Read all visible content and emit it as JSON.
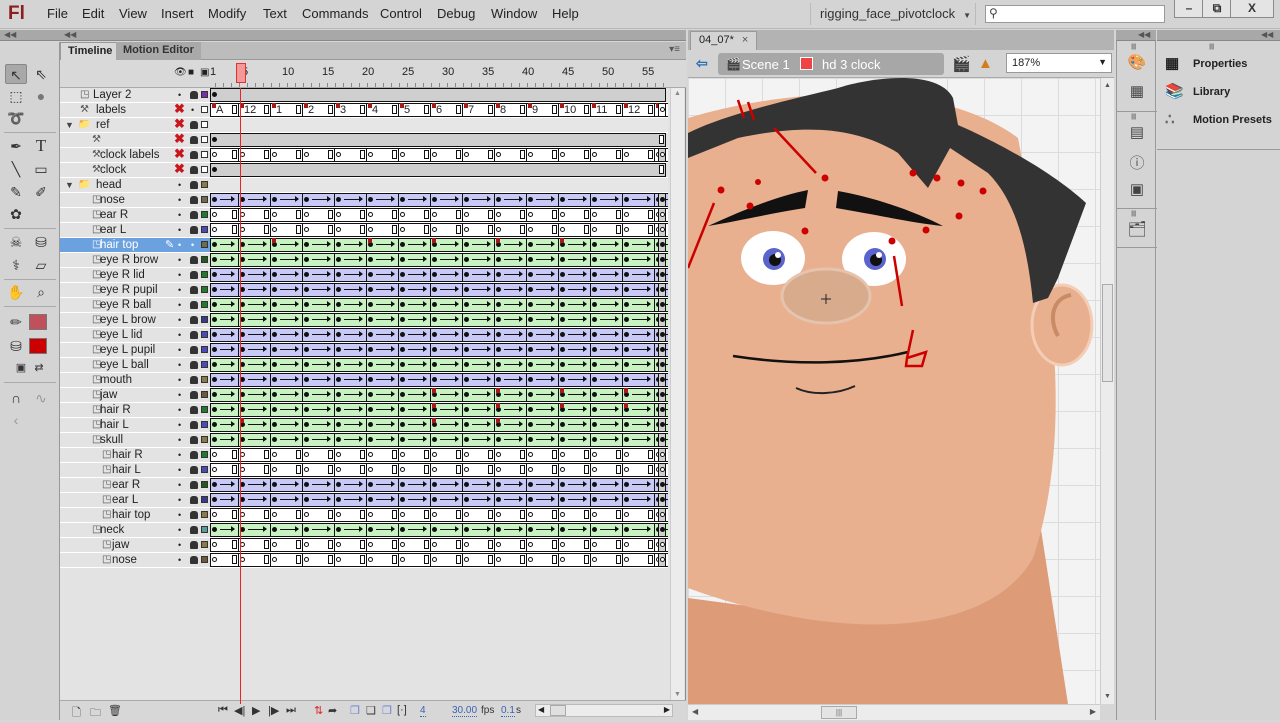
{
  "app": {
    "logo": "Fl",
    "menu": [
      "File",
      "Edit",
      "View",
      "Insert",
      "Modify",
      "Text",
      "Commands",
      "Control",
      "Debug",
      "Window",
      "Help"
    ],
    "workspace": "rigging_face_pivotclock",
    "search_placeholder": "",
    "window_buttons": {
      "minimize": "–",
      "restore": "⧉",
      "close": "X"
    }
  },
  "toolbox": {
    "tools": [
      {
        "name": "selection-tool",
        "glyph": "↖",
        "active": true
      },
      {
        "name": "subselection-tool",
        "glyph": "⇖"
      },
      {
        "name": "free-transform-tool",
        "glyph": "⬚"
      },
      {
        "name": "3d-rotation-tool",
        "glyph": "●"
      },
      {
        "name": "lasso-tool",
        "glyph": "➰"
      },
      {
        "name": "pen-tool",
        "glyph": "✒"
      },
      {
        "name": "text-tool",
        "glyph": "T"
      },
      {
        "name": "line-tool",
        "glyph": "╲"
      },
      {
        "name": "rectangle-tool",
        "glyph": "▭"
      },
      {
        "name": "pencil-tool",
        "glyph": "✎"
      },
      {
        "name": "brush-tool",
        "glyph": "✐"
      },
      {
        "name": "deco-tool",
        "glyph": "✿"
      },
      {
        "name": "bone-tool",
        "glyph": "☠"
      },
      {
        "name": "paint-bucket-tool",
        "glyph": "⛁"
      },
      {
        "name": "eyedropper-tool",
        "glyph": "⚕"
      },
      {
        "name": "eraser-tool",
        "glyph": "▱"
      },
      {
        "name": "hand-tool",
        "glyph": "✋"
      },
      {
        "name": "zoom-tool",
        "glyph": "⌕"
      },
      {
        "name": "stroke-color-tool",
        "glyph": "✏"
      },
      {
        "name": "fill-color-tool",
        "glyph": "⛁"
      },
      {
        "name": "default-colors-tool",
        "glyph": "▣"
      },
      {
        "name": "swap-colors-tool",
        "glyph": "⇄"
      },
      {
        "name": "snap-to-objects-tool",
        "glyph": "∩"
      },
      {
        "name": "smooth-tool",
        "glyph": "∿"
      },
      {
        "name": "straighten-tool",
        "glyph": "‹"
      }
    ],
    "stroke_color": "#c0505a",
    "fill_color": "#cc0000"
  },
  "timeline": {
    "tabs": [
      {
        "label": "Timeline",
        "active": true
      },
      {
        "label": "Motion Editor",
        "active": false
      }
    ],
    "ruler": [
      "1",
      "5",
      "10",
      "15",
      "20",
      "25",
      "30",
      "35",
      "40",
      "45",
      "50",
      "55"
    ],
    "current_frame": "4",
    "fps": "30.00",
    "fps_unit": "fps",
    "elapsed": "0.1",
    "elapsed_unit": "s",
    "total_frames": 57,
    "layers": [
      {
        "name": "Layer 2",
        "depth": 0,
        "kind": "layer",
        "frames": "gray-single",
        "color": "#7a2fa8"
      },
      {
        "name": "labels",
        "depth": 0,
        "kind": "guide",
        "frames": "labels",
        "hidden": true,
        "color": "#ffffff"
      },
      {
        "name": "ref",
        "depth": 0,
        "kind": "folder",
        "frames": "folder",
        "hidden": true,
        "color": "#ffffff"
      },
      {
        "name": "",
        "depth": 1,
        "kind": "guide",
        "frames": "gray-single-end",
        "hidden": true,
        "color": "#ffffff"
      },
      {
        "name": "clock labels",
        "depth": 1,
        "kind": "guide",
        "frames": "white",
        "hidden": true,
        "color": "#ffffff"
      },
      {
        "name": "clock",
        "depth": 1,
        "kind": "guide",
        "frames": "gray-single-end",
        "hidden": true,
        "color": "#ffffff"
      },
      {
        "name": "head",
        "depth": 0,
        "kind": "folder",
        "frames": "folder",
        "color": "#8a7a4a"
      },
      {
        "name": "nose",
        "depth": 1,
        "kind": "layer",
        "frames": "blue",
        "color": "#6e6a4a"
      },
      {
        "name": "ear R",
        "depth": 1,
        "kind": "layer",
        "frames": "white",
        "color": "#1f7a2a"
      },
      {
        "name": "ear L",
        "depth": 1,
        "kind": "layer",
        "frames": "white",
        "color": "#4a4ab8"
      },
      {
        "name": "hair top",
        "depth": 1,
        "kind": "layer",
        "frames": "green",
        "selected": true,
        "flags": [
          8,
          20,
          28,
          36,
          44
        ],
        "color": "#6e6a4a"
      },
      {
        "name": "eye R brow",
        "depth": 1,
        "kind": "layer",
        "frames": "green",
        "color": "#1f5a1f"
      },
      {
        "name": "eye R lid",
        "depth": 1,
        "kind": "layer",
        "frames": "blue",
        "color": "#1f7a2a"
      },
      {
        "name": "eye R pupil",
        "depth": 1,
        "kind": "layer",
        "frames": "blue",
        "color": "#1f7a2a"
      },
      {
        "name": "eye R ball",
        "depth": 1,
        "kind": "layer",
        "frames": "green",
        "color": "#1f7a2a"
      },
      {
        "name": "eye L brow",
        "depth": 1,
        "kind": "layer",
        "frames": "green",
        "color": "#3a3a8a"
      },
      {
        "name": "eye L lid",
        "depth": 1,
        "kind": "layer",
        "frames": "blue",
        "color": "#4a4ab8"
      },
      {
        "name": "eye L pupil",
        "depth": 1,
        "kind": "layer",
        "frames": "blue",
        "color": "#4a4ab8"
      },
      {
        "name": "eye L ball",
        "depth": 1,
        "kind": "layer",
        "frames": "green",
        "color": "#4a4ab8"
      },
      {
        "name": "mouth",
        "depth": 1,
        "kind": "layer",
        "frames": "blue",
        "color": "#8a7a4a"
      },
      {
        "name": "jaw",
        "depth": 1,
        "kind": "layer",
        "frames": "green",
        "flags": [
          28,
          36,
          44,
          52
        ],
        "color": "#6e5a3a"
      },
      {
        "name": "hair R",
        "depth": 1,
        "kind": "layer",
        "frames": "green",
        "flags": [
          28,
          36,
          44,
          52
        ],
        "color": "#1f7a2a"
      },
      {
        "name": "hair L",
        "depth": 1,
        "kind": "layer",
        "frames": "green",
        "flags": [
          4,
          28,
          36
        ],
        "color": "#4a4ab8"
      },
      {
        "name": "skull",
        "depth": 1,
        "kind": "layer",
        "frames": "green",
        "color": "#8a7a4a"
      },
      {
        "name": "hair R",
        "depth": 2,
        "kind": "layer",
        "frames": "white",
        "color": "#1f7a2a"
      },
      {
        "name": "hair L",
        "depth": 2,
        "kind": "layer",
        "frames": "white",
        "color": "#4a4ab8"
      },
      {
        "name": "ear R",
        "depth": 2,
        "kind": "layer",
        "frames": "blue",
        "color": "#1f5a1f"
      },
      {
        "name": "ear L",
        "depth": 2,
        "kind": "layer",
        "frames": "blue",
        "color": "#3a3a8a"
      },
      {
        "name": "hair top",
        "depth": 2,
        "kind": "layer",
        "frames": "white",
        "color": "#8a7a4a"
      },
      {
        "name": "neck",
        "depth": 1,
        "kind": "layer",
        "frames": "green",
        "color": "#5a9a9a"
      },
      {
        "name": "jaw",
        "depth": 2,
        "kind": "layer",
        "frames": "white",
        "color": "#8a7a4a"
      },
      {
        "name": "nose",
        "depth": 2,
        "kind": "layer",
        "frames": "white",
        "color": "#6e5a3a"
      }
    ],
    "frame_labels": [
      "A",
      "12",
      "1",
      "2",
      "3",
      "4",
      "5",
      "6",
      "7",
      "8",
      "9",
      "10",
      "11",
      "12"
    ]
  },
  "document": {
    "tab_label": "04_07*",
    "close_glyph": "×",
    "breadcrumbs": [
      {
        "label": "Scene 1",
        "icon": "scene-icon"
      },
      {
        "label": "hd 3 clock",
        "icon": "symbol-icon"
      }
    ],
    "zoom": "187%"
  },
  "panels": {
    "items": [
      {
        "label": "Properties",
        "icon": "properties-icon"
      },
      {
        "label": "Library",
        "icon": "library-icon"
      },
      {
        "label": "Motion Presets",
        "icon": "motion-presets-icon"
      }
    ]
  },
  "colors": {
    "skin": "#e8b08f",
    "skin_shadow": "#dd9b78",
    "hair": "#333333",
    "nose": "#d8ab8d",
    "iris": "#5b63cc",
    "guide_red": "#cc0000"
  }
}
